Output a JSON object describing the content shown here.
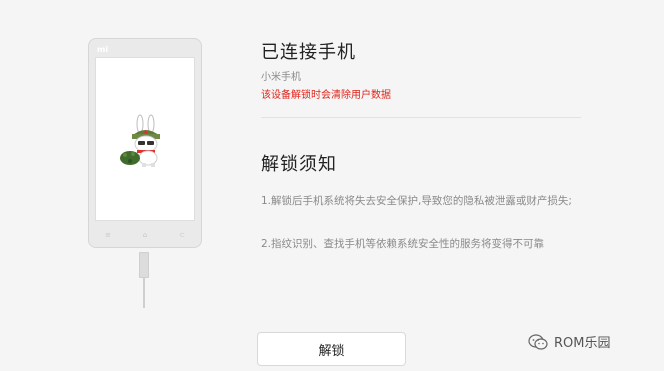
{
  "phone": {
    "brand_logo": "mi",
    "nav_keys": [
      "≡",
      "⌂",
      "⊂"
    ]
  },
  "header": {
    "title": "已连接手机",
    "device_name": "小米手机",
    "warning": "该设备解锁时会清除用户数据"
  },
  "notice": {
    "title": "解锁须知",
    "items": [
      "1.解锁后手机系统将失去安全保护,导致您的隐私被泄露或财产损失;",
      "2.指纹识别、查找手机等依赖系统安全性的服务将变得不可靠"
    ]
  },
  "actions": {
    "unlock_label": "解锁"
  },
  "watermark": {
    "text": "ROM乐园",
    "icon": "wechat-icon"
  },
  "colors": {
    "warning": "#e0241b",
    "background": "#f5f5f5"
  }
}
